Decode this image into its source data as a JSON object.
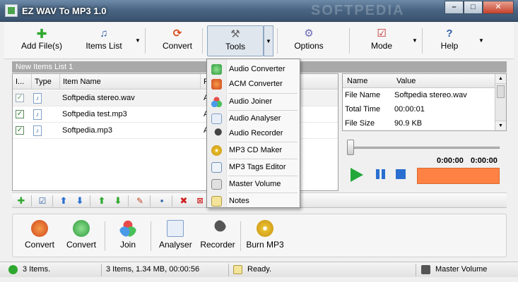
{
  "window": {
    "title": "EZ WAV To MP3 1.0",
    "watermark": "SOFTPEDIA",
    "controls": [
      "–",
      "□",
      "✕"
    ]
  },
  "toolbar": {
    "add_files": "Add File(s)",
    "items_list": "Items List",
    "convert": "Convert",
    "tools": "Tools",
    "options": "Options",
    "mode": "Mode",
    "help": "Help"
  },
  "list": {
    "header": "New Items List 1",
    "columns": [
      "I...",
      "Type",
      "Item Name",
      "F"
    ],
    "rows": [
      {
        "name": "Softpedia stereo.wav",
        "trunc": "A",
        "checked": true
      },
      {
        "name": "Softpedia test.mp3",
        "trunc": "A",
        "checked": true
      },
      {
        "name": "Softpedia.mp3",
        "trunc": "A",
        "checked": true
      }
    ]
  },
  "properties": {
    "columns": [
      "Name",
      "Value"
    ],
    "rows": [
      {
        "name": "File Name",
        "value": "Softpedia stereo.wav"
      },
      {
        "name": "Total Time",
        "value": "00:00:01"
      },
      {
        "name": "File Size",
        "value": "90.9 KB"
      }
    ]
  },
  "player": {
    "elapsed": "0:00:00",
    "total": "0:00:00",
    "progress": 0
  },
  "menu": {
    "items": [
      "Audio Converter",
      "ACM Converter",
      "Audio Joiner",
      "Audio Analyser",
      "Audio Recorder",
      "MP3 CD Maker",
      "MP3 Tags Editor",
      "Master Volume",
      "Notes"
    ]
  },
  "bottom": {
    "convert1": "Convert",
    "convert2": "Convert",
    "join": "Join",
    "analyser": "Analyser",
    "recorder": "Recorder",
    "burn": "Burn MP3"
  },
  "status": {
    "items": "3 Items.",
    "summary": "3 Items, 1.34 MB, 00:00:56",
    "state": "Ready.",
    "volume": "Master Volume"
  },
  "colors": {
    "meter": "#ff8244",
    "accent": "#2a6fd0",
    "play": "#22a83a"
  }
}
